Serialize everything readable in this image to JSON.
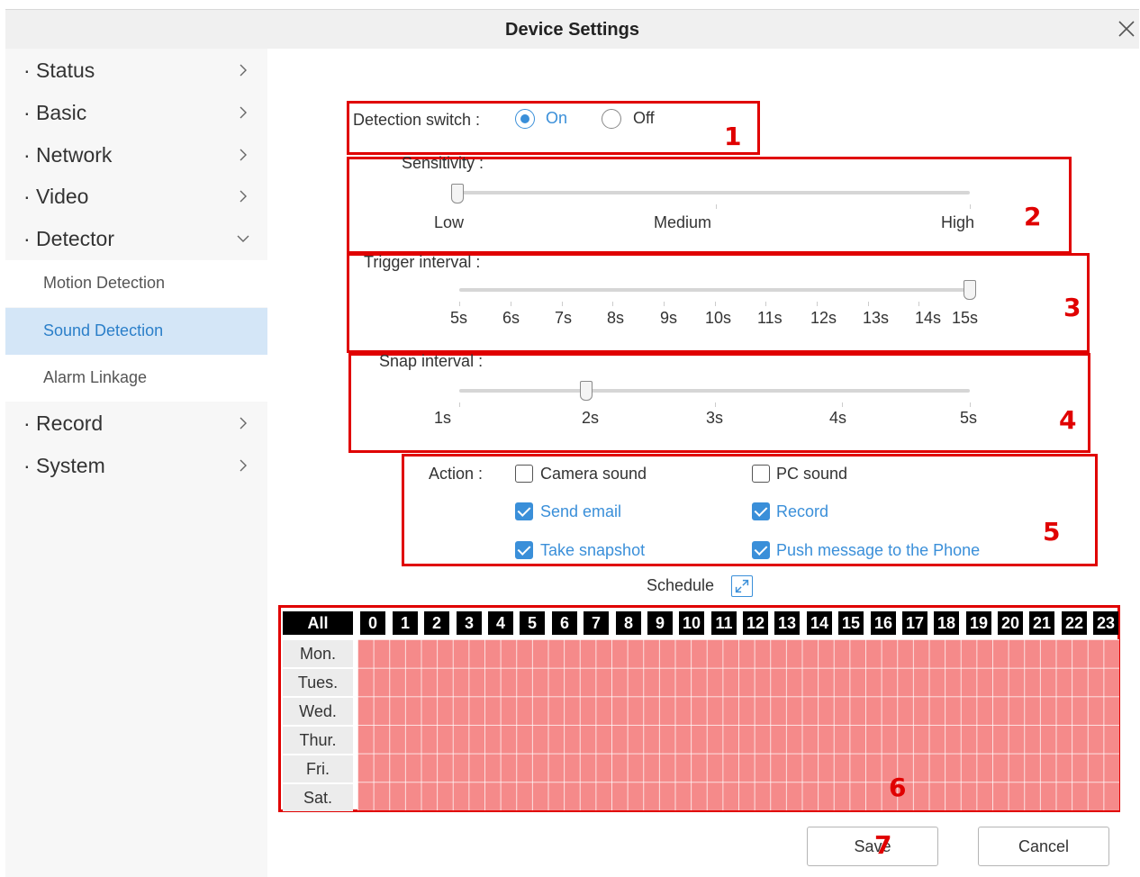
{
  "window": {
    "title": "Device Settings"
  },
  "sidebar": {
    "items": [
      {
        "label": "· Status"
      },
      {
        "label": "· Basic"
      },
      {
        "label": "· Network"
      },
      {
        "label": "· Video"
      },
      {
        "label": "· Detector"
      },
      {
        "label": "· Record"
      },
      {
        "label": "· System"
      }
    ],
    "detector_sub": [
      {
        "label": "Motion Detection",
        "active": false
      },
      {
        "label": "Sound Detection",
        "active": true
      },
      {
        "label": "Alarm Linkage",
        "active": false
      }
    ]
  },
  "detection_switch": {
    "label": "Detection switch :",
    "on_label": "On",
    "off_label": "Off",
    "value": "On"
  },
  "sensitivity": {
    "label": "Sensitivity :",
    "ticks": [
      "Low",
      "Medium",
      "High"
    ],
    "value": "Low"
  },
  "trigger_interval": {
    "label": "Trigger interval :",
    "ticks": [
      "5s",
      "6s",
      "7s",
      "8s",
      "9s",
      "10s",
      "11s",
      "12s",
      "13s",
      "14s",
      "15s"
    ],
    "value": "15s"
  },
  "snap_interval": {
    "label": "Snap interval :",
    "ticks": [
      "1s",
      "2s",
      "3s",
      "4s",
      "5s"
    ],
    "value": "2s"
  },
  "action": {
    "label": "Action :",
    "options": [
      {
        "label": "Camera sound",
        "checked": false
      },
      {
        "label": "PC sound",
        "checked": false
      },
      {
        "label": "Send email",
        "checked": true
      },
      {
        "label": "Record",
        "checked": true
      },
      {
        "label": "Take snapshot",
        "checked": true
      },
      {
        "label": "Push message to the Phone",
        "checked": true
      }
    ]
  },
  "schedule": {
    "title": "Schedule",
    "all_label": "All",
    "hours": [
      "0",
      "1",
      "2",
      "3",
      "4",
      "5",
      "6",
      "7",
      "8",
      "9",
      "10",
      "11",
      "12",
      "13",
      "14",
      "15",
      "16",
      "17",
      "18",
      "19",
      "20",
      "21",
      "22",
      "23"
    ],
    "days": [
      "Mon.",
      "Tues.",
      "Wed.",
      "Thur.",
      "Fri.",
      "Sat."
    ]
  },
  "markers": [
    "1",
    "2",
    "3",
    "4",
    "5",
    "6",
    "7"
  ],
  "buttons": {
    "save": "Save",
    "cancel": "Cancel"
  },
  "colors": {
    "accent": "#3a8fd9",
    "annotation": "#e00000",
    "schedule_fill": "#f58a8a",
    "active_bg": "#d4e6f7"
  }
}
